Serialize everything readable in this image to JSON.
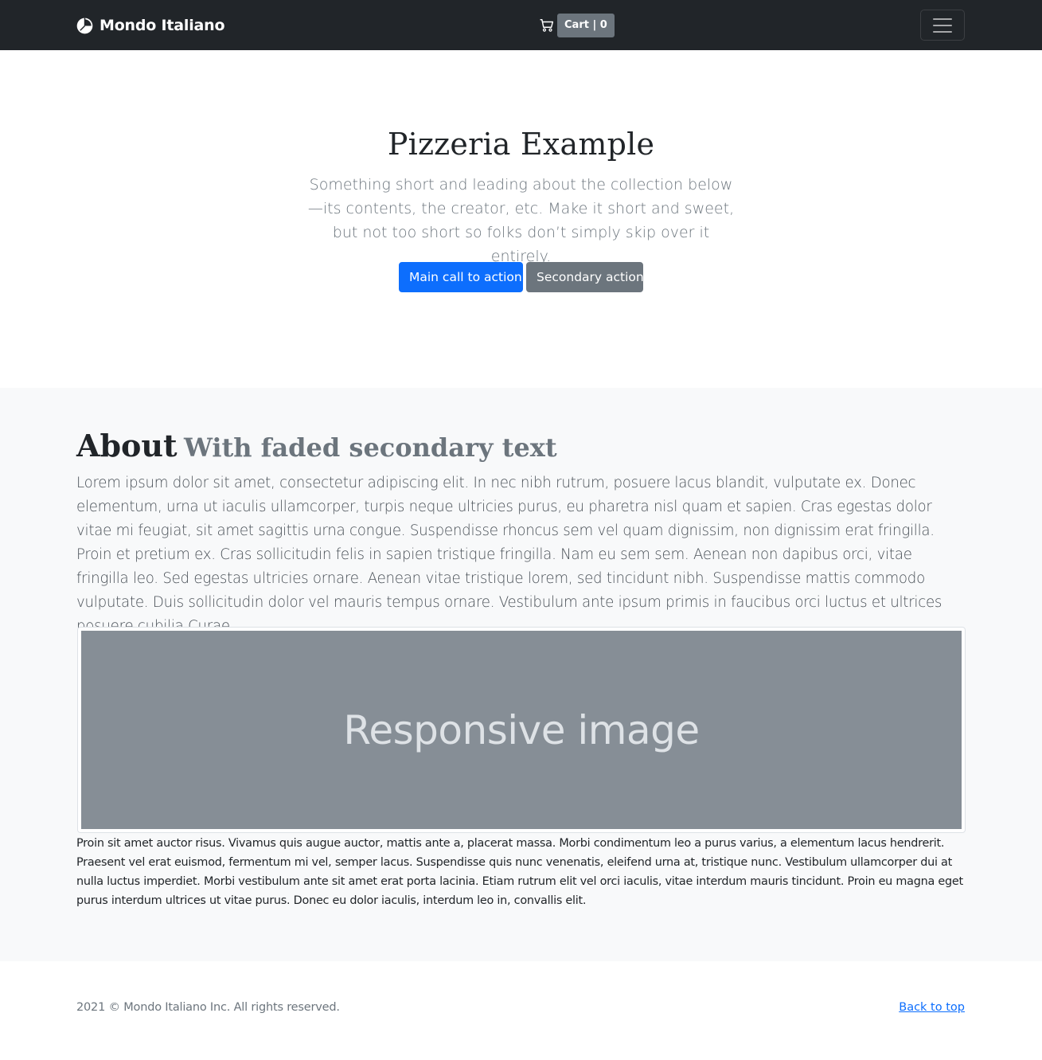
{
  "navbar": {
    "brand": "Mondo Italiano",
    "brand_icon": "pie-chart-icon",
    "cart_icon": "cart-icon",
    "cart_label": "Cart | 0",
    "toggler_icon": "hamburger-menu-icon"
  },
  "hero": {
    "title": "Pizzeria Example",
    "lead": "Something short and leading about the collection below—its contents, the creator, etc. Make it short and sweet, but not too short so folks don’t simply skip over it entirely.",
    "primary_button": "Main call to action",
    "secondary_button": "Secondary action"
  },
  "about": {
    "heading": "About",
    "heading_muted": "With faded secondary text",
    "lead": "Lorem ipsum dolor sit amet, consectetur adipiscing elit. In nec nibh rutrum, posuere lacus blandit, vulputate ex. Donec elementum, urna ut iaculis ullamcorper, turpis neque ultricies purus, eu pharetra nisl quam et sapien. Cras egestas dolor vitae mi feugiat, sit amet sagittis urna congue. Suspendisse rhoncus sem vel quam dignissim, non dignissim erat fringilla. Proin et pretium ex. Cras sollicitudin felis in sapien tristique fringilla. Nam eu sem sem. Aenean non dapibus orci, vitae fringilla leo. Sed egestas ultricies ornare. Aenean vitae tristique lorem, sed tincidunt nibh. Suspendisse mattis commodo vulputate. Duis sollicitudin dolor vel mauris tempus ornare. Vestibulum ante ipsum primis in faucibus orci luctus et ultrices posuere cubilia Curae.",
    "image_label": "Responsive image",
    "body": "Proin sit amet auctor risus. Vivamus quis augue auctor, mattis ante a, placerat massa. Morbi condimentum leo a purus varius, a elementum lacus hendrerit. Praesent vel erat euismod, fermentum mi vel, semper lacus. Suspendisse quis nunc venenatis, eleifend urna at, tristique nunc. Vestibulum ullamcorper dui at nulla luctus imperdiet. Morbi vestibulum ante sit amet erat porta lacinia. Etiam rutrum elit vel orci iaculis, vitae interdum mauris tincidunt. Proin eu magna eget purus interdum ultrices ut vitae purus. Donec eu dolor iaculis, interdum leo in, convallis elit."
  },
  "footer": {
    "copyright": "2021 © Mondo Italiano Inc. All rights reserved.",
    "back_to_top": "Back to top"
  },
  "colors": {
    "navbar_bg": "#212529",
    "primary": "#0d6efd",
    "secondary": "#6c757d",
    "section_bg": "#f8f9fa",
    "placeholder_bg": "#868e96"
  }
}
